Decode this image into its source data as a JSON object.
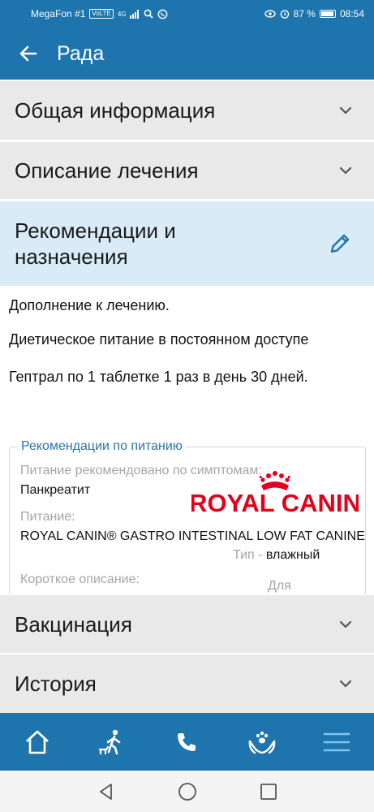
{
  "status_bar": {
    "carrier": "MegaFon #1",
    "volte_badge": "VoLTE",
    "network": "4G",
    "battery_percent": "87 %",
    "battery_level": 0.87,
    "time": "08:54",
    "icons": [
      "signal-icon",
      "search-icon",
      "whatsapp-icon",
      "eye-icon",
      "alarm-icon",
      "battery-icon"
    ]
  },
  "appbar": {
    "title": "Рада",
    "back_icon": "arrow-left-icon"
  },
  "sections": {
    "general": {
      "title": "Общая информация",
      "icon": "chevron-down-icon"
    },
    "treatment": {
      "title": "Описание лечения",
      "icon": "chevron-down-icon"
    },
    "recommendations": {
      "title_line1": "Рекомендации и",
      "title_line2": "назначения",
      "icon": "pencil-icon"
    },
    "vaccination": {
      "title": "Вакцинация",
      "icon": "chevron-down-icon"
    },
    "history": {
      "title": "История",
      "icon": "chevron-down-icon"
    }
  },
  "recommendations": {
    "paragraphs": [
      "Дополнение к лечению.",
      "Диетическое питание в постоянном доступе",
      "Гептрал по 1 таблетке 1 раз в день 30 дней."
    ],
    "nutrition": {
      "legend": "Рекомендации по питанию",
      "symptoms_label": "Питание рекомендовано по симптомам:",
      "symptoms_value": "Панкреатит",
      "food_label": "Питание:",
      "food_value": "ROYAL CANIN® GASTRO INTESTINAL LOW FAT CANINE",
      "type_label": "Тип -",
      "type_value": "влажный",
      "short_desc_label": "Короткое описание:",
      "short_desc_value": "Для",
      "brand_logo_text": "ROYAL CANIN",
      "brand_color": "#e2001a"
    }
  },
  "bottom_nav": {
    "items": [
      {
        "name": "home-icon"
      },
      {
        "name": "walking-pet-icon"
      },
      {
        "name": "phone-icon"
      },
      {
        "name": "pet-care-icon"
      },
      {
        "name": "menu-icon"
      }
    ]
  },
  "system_nav": {
    "items": [
      "back-triangle-icon",
      "home-circle-icon",
      "recents-square-icon"
    ]
  },
  "colors": {
    "primary": "#1e74ad",
    "section_bg": "#e9e9e9",
    "active_section_bg": "#d9ebf7",
    "label_gray": "#a5a5a5",
    "legend_blue": "#2b74a8",
    "menu_icon": "#7fc4ee"
  }
}
